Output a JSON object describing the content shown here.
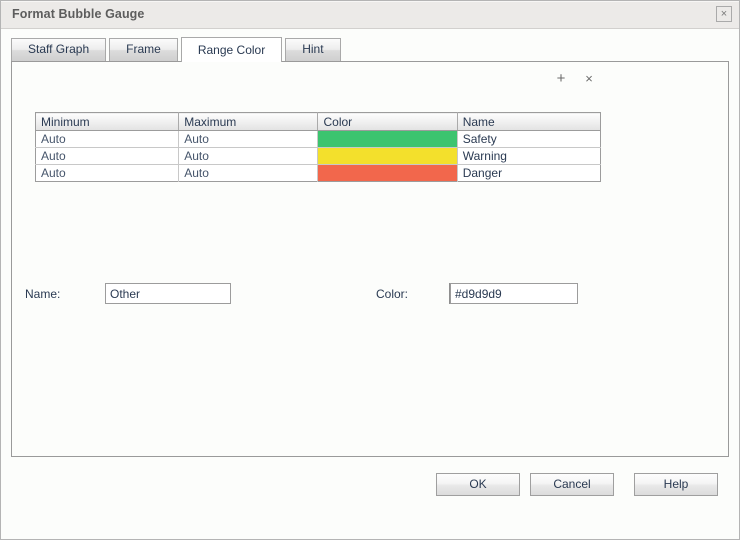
{
  "window": {
    "title": "Format Bubble Gauge",
    "close_label": "×"
  },
  "tabs": [
    {
      "label": "Staff Graph",
      "active": false
    },
    {
      "label": "Frame",
      "active": false
    },
    {
      "label": "Range Color",
      "active": true
    },
    {
      "label": "Hint",
      "active": false
    }
  ],
  "grid_toolbar": {
    "add_label": "+",
    "remove_label": "×"
  },
  "grid": {
    "columns": [
      "Minimum",
      "Maximum",
      "Color",
      "Name"
    ],
    "rows": [
      {
        "minimum": "Auto",
        "maximum": "Auto",
        "color": "#3cc46f",
        "name": "Safety"
      },
      {
        "minimum": "Auto",
        "maximum": "Auto",
        "color": "#f3e02c",
        "name": "Warning"
      },
      {
        "minimum": "Auto",
        "maximum": "Auto",
        "color": "#f2674c",
        "name": "Danger"
      }
    ]
  },
  "fields": {
    "name_label": "Name:",
    "name_value": "Other",
    "name_placeholder": "",
    "color_label": "Color:",
    "color_value": "#d9d9d9",
    "color_placeholder": "",
    "color_swatch": "#d9d9d9"
  },
  "footer": {
    "ok_label": "OK",
    "cancel_label": "Cancel",
    "help_label": "Help"
  }
}
